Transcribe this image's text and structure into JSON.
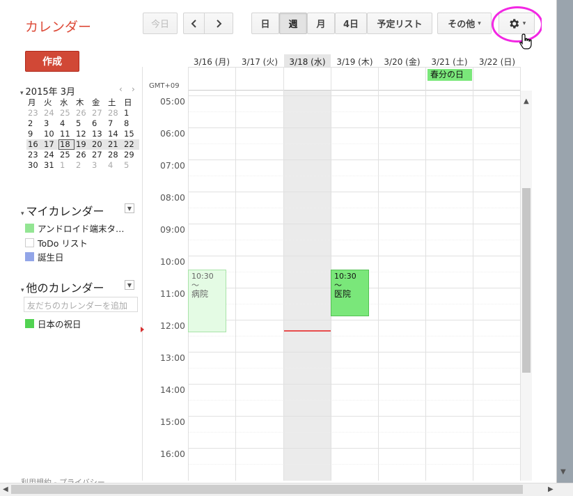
{
  "header": {
    "app_title": "カレンダー",
    "today_label": "今日",
    "prev_icon": "chevron-left",
    "next_icon": "chevron-right",
    "views": [
      "日",
      "週",
      "月",
      "4日",
      "予定リスト"
    ],
    "active_view": "週",
    "more_label": "その他",
    "settings_icon": "gear",
    "highlight_color": "#f227e3"
  },
  "sidebar": {
    "create_label": "作成",
    "mini_calendar": {
      "title": "2015年 3月",
      "prev": "‹",
      "next": "›",
      "weekdays": [
        "月",
        "火",
        "水",
        "木",
        "金",
        "土",
        "日"
      ],
      "weeks": [
        [
          "23",
          "24",
          "25",
          "26",
          "27",
          "28",
          "1"
        ],
        [
          "2",
          "3",
          "4",
          "5",
          "6",
          "7",
          "8"
        ],
        [
          "9",
          "10",
          "11",
          "12",
          "13",
          "14",
          "15"
        ],
        [
          "16",
          "17",
          "18",
          "19",
          "20",
          "21",
          "22"
        ],
        [
          "23",
          "24",
          "25",
          "26",
          "27",
          "28",
          "29"
        ],
        [
          "30",
          "31",
          "1",
          "2",
          "3",
          "4",
          "5"
        ]
      ],
      "selected_day": "18"
    },
    "my_calendars": {
      "title": "マイカレンダー",
      "items": [
        {
          "label": "アンドロイド端末タ…",
          "color": "#93e593"
        },
        {
          "label": "ToDo リスト",
          "color": "#ffffff"
        },
        {
          "label": "誕生日",
          "color": "#92a5e8"
        }
      ]
    },
    "other_calendars": {
      "title": "他のカレンダー",
      "add_placeholder": "友だちのカレンダーを追加",
      "items": [
        {
          "label": "日本の祝日",
          "color": "#52d352"
        }
      ]
    },
    "footer": "利用規約 - プライバシー"
  },
  "week": {
    "timezone": "GMT+09",
    "days": [
      "3/16 (月)",
      "3/17 (火)",
      "3/18 (水)",
      "3/19 (木)",
      "3/20 (金)",
      "3/21 (土)",
      "3/22 (日)"
    ],
    "today_index": 2,
    "all_day_events": [
      {
        "day_index": 5,
        "title": "春分の日",
        "color": "#7ae77a"
      }
    ],
    "hours": [
      "05:00",
      "06:00",
      "07:00",
      "08:00",
      "09:00",
      "10:00",
      "11:00",
      "12:00",
      "13:00",
      "14:00",
      "15:00",
      "16:00"
    ],
    "events": [
      {
        "day_index": 0,
        "time": "10:30 ～",
        "title": "病院"
      },
      {
        "day_index": 3,
        "time": "10:30 ～",
        "title": "医院"
      }
    ]
  }
}
